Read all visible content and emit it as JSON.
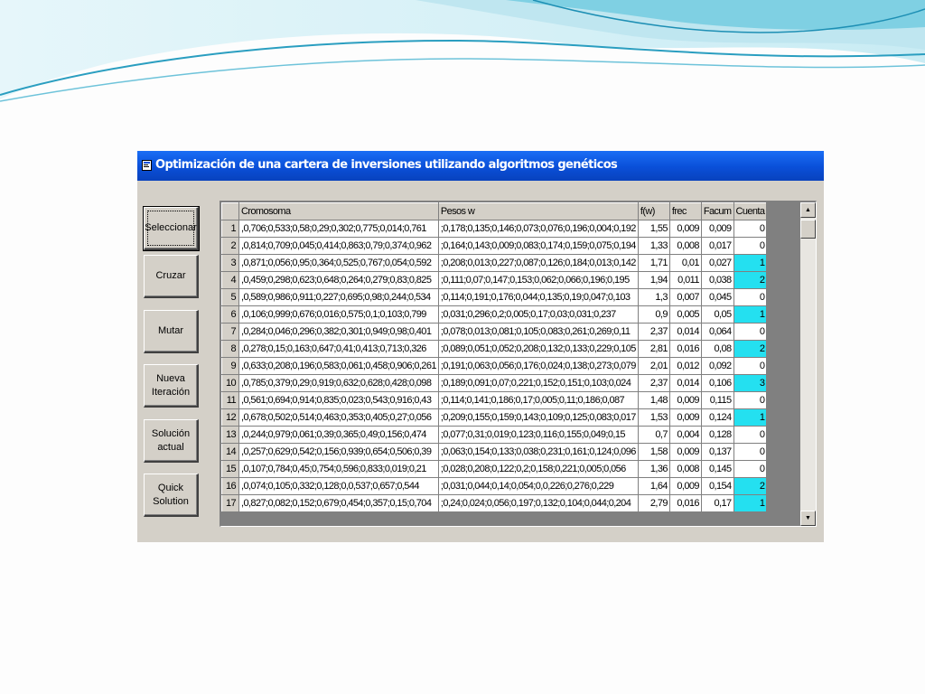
{
  "window": {
    "title": "Optimización de una cartera de inversiones utilizando algoritmos genéticos"
  },
  "buttons": [
    {
      "id": "seleccionar",
      "label": "Seleccionar",
      "focused": true
    },
    {
      "id": "cruzar",
      "label": "Cruzar"
    },
    {
      "id": "mutar",
      "label": "Mutar"
    },
    {
      "id": "nueva-iteracion",
      "label": "Nueva\nIteración"
    },
    {
      "id": "solucion-actual",
      "label": "Solución\nactual"
    },
    {
      "id": "quick-solution",
      "label": "Quick\nSolution"
    }
  ],
  "grid": {
    "columns": [
      "",
      "Cromosoma",
      "Pesos w",
      "f(w)",
      "frec",
      "Facum",
      "Cuenta"
    ],
    "highlight_color": "#24e0f0",
    "rows": [
      [
        "1",
        ",0,706;0,533;0,58;0,29;0,302;0,775;0,014;0,761",
        ";0,178;0,135;0,146;0,073;0,076;0,196;0,004;0,192",
        "1,55",
        "0,009",
        "0,009",
        "0"
      ],
      [
        "2",
        ",0,814;0,709;0,045;0,414;0,863;0,79;0,374;0,962",
        ";0,164;0,143;0,009;0,083;0,174;0,159;0,075;0,194",
        "1,33",
        "0,008",
        "0,017",
        "0"
      ],
      [
        "3",
        ",0,871;0,056;0,95;0,364;0,525;0,767;0,054;0,592",
        ";0,208;0,013;0,227;0,087;0,126;0,184;0,013;0,142",
        "1,71",
        "0,01",
        "0,027",
        "1"
      ],
      [
        "4",
        ",0,459;0,298;0,623;0,648;0,264;0,279;0,83;0,825",
        ";0,111;0,07;0,147;0,153;0,062;0,066;0,196;0,195",
        "1,94",
        "0,011",
        "0,038",
        "2"
      ],
      [
        "5",
        ",0,589;0,986;0,911;0,227;0,695;0,98;0,244;0,534",
        ";0,114;0,191;0,176;0,044;0,135;0,19;0,047;0,103",
        "1,3",
        "0,007",
        "0,045",
        "0"
      ],
      [
        "6",
        ",0,106;0,999;0,676;0,016;0,575;0,1;0,103;0,799",
        ";0,031;0,296;0,2;0,005;0,17;0,03;0,031;0,237",
        "0,9",
        "0,005",
        "0,05",
        "1"
      ],
      [
        "7",
        ",0,284;0,046;0,296;0,382;0,301;0,949;0,98;0,401",
        ";0,078;0,013;0,081;0,105;0,083;0,261;0,269;0,11",
        "2,37",
        "0,014",
        "0,064",
        "0"
      ],
      [
        "8",
        ",0,278;0,15;0,163;0,647;0,41;0,413;0,713;0,326",
        ";0,089;0,051;0,052;0,208;0,132;0,133;0,229;0,105",
        "2,81",
        "0,016",
        "0,08",
        "2"
      ],
      [
        "9",
        ",0,633;0,208;0,196;0,583;0,061;0,458;0,906;0,261",
        ";0,191;0,063;0,056;0,176;0,024;0,138;0,273;0,079",
        "2,01",
        "0,012",
        "0,092",
        "0"
      ],
      [
        "10",
        ",0,785;0,379;0,29;0,919;0,632;0,628;0,428;0,098",
        ";0,189;0,091;0,07;0,221;0,152;0,151;0,103;0,024",
        "2,37",
        "0,014",
        "0,106",
        "3"
      ],
      [
        "11",
        ",0,561;0,694;0,914;0,835;0,023;0,543;0,916;0,43",
        ";0,114;0,141;0,186;0,17;0,005;0,11;0,186;0,087",
        "1,48",
        "0,009",
        "0,115",
        "0"
      ],
      [
        "12",
        ",0,678;0,502;0,514;0,463;0,353;0,405;0,27;0,056",
        ";0,209;0,155;0,159;0,143;0,109;0,125;0,083;0,017",
        "1,53",
        "0,009",
        "0,124",
        "1"
      ],
      [
        "13",
        ",0,244;0,979;0,061;0,39;0,365;0,49;0,156;0,474",
        ";0,077;0,31;0,019;0,123;0,116;0,155;0,049;0,15",
        "0,7",
        "0,004",
        "0,128",
        "0"
      ],
      [
        "14",
        ",0,257;0,629;0,542;0,156;0,939;0,654;0,506;0,39",
        ";0,063;0,154;0,133;0,038;0,231;0,161;0,124;0,096",
        "1,58",
        "0,009",
        "0,137",
        "0"
      ],
      [
        "15",
        ",0,107;0,784;0,45;0,754;0,596;0,833;0,019;0,21",
        ";0,028;0,208;0,122;0,2;0,158;0,221;0,005;0,056",
        "1,36",
        "0,008",
        "0,145",
        "0"
      ],
      [
        "16",
        ",0,074;0,105;0,332;0,128;0,0,537;0,657;0,544",
        ";0,031;0,044;0,14;0,054;0,0,226;0,276;0,229",
        "1,64",
        "0,009",
        "0,154",
        "2"
      ],
      [
        "17",
        ",0,827;0,082;0,152;0,679;0,454;0,357;0,15;0,704",
        ";0,24;0,024;0,056;0,197;0,132;0,104;0,044;0,204",
        "2,79",
        "0,016",
        "0,17",
        "1"
      ]
    ]
  }
}
